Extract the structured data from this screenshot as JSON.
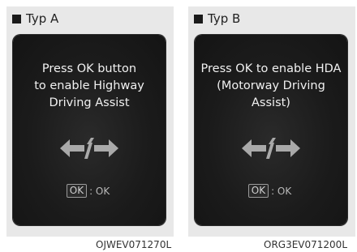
{
  "panels": [
    {
      "label": "Typ A",
      "message_lines": [
        "Press OK button",
        "to enable Highway",
        "Driving Assist"
      ],
      "ok_key": "OK",
      "ok_text": ": OK",
      "caption": "OJWEV071270L"
    },
    {
      "label": "Typ B",
      "message_lines": [
        "Press OK to enable HDA",
        "(Motorway Driving",
        "Assist)"
      ],
      "ok_key": "OK",
      "ok_text": ": OK",
      "caption": "ORG3EV071200L"
    }
  ],
  "icons": [
    "lane-change-arrows-icon"
  ],
  "colors": {
    "screen_bg": "#1b1b1b",
    "panel_bg": "#e8e8e8",
    "text": "#f1f1f1"
  }
}
